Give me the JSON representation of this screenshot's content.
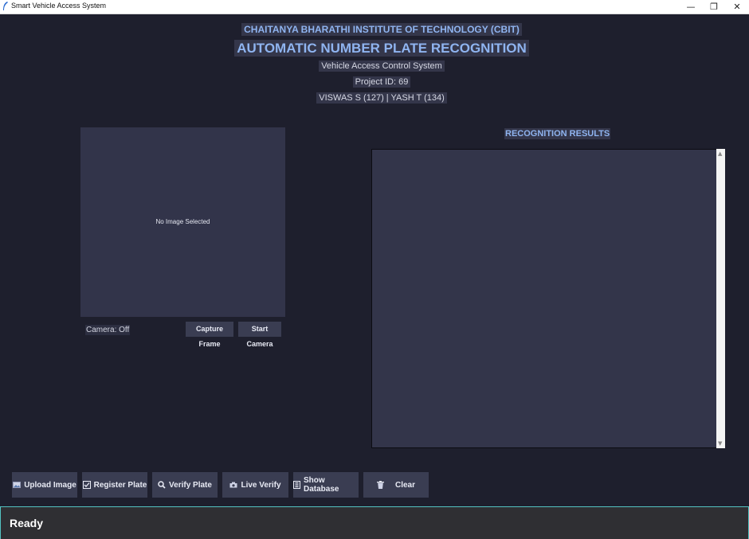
{
  "window": {
    "title": "Smart Vehicle Access System",
    "controls": {
      "minimize": "—",
      "restore": "❐",
      "close": "✕"
    }
  },
  "header": {
    "institute": "CHAITANYA BHARATHI INSTITUTE OF TECHNOLOGY (CBIT)",
    "title": "AUTOMATIC NUMBER PLATE RECOGNITION",
    "subtitle": "Vehicle Access Control System",
    "project_id": "Project ID: 69",
    "authors": "VISWAS S (127) | YASH T (134)"
  },
  "image_panel": {
    "placeholder": "No Image Selected"
  },
  "camera": {
    "status": "Camera: Off",
    "capture_label": "Capture Frame",
    "start_label": "Start Camera"
  },
  "results": {
    "title": "RECOGNITION RESULTS",
    "content": ""
  },
  "actions": [
    {
      "label": "Upload Image",
      "icon": "image-icon"
    },
    {
      "label": "Register Plate",
      "icon": "checkbox-icon"
    },
    {
      "label": "Verify Plate",
      "icon": "magnifier-icon"
    },
    {
      "label": "Live Verify",
      "icon": "camera-icon"
    },
    {
      "label": "Show Database",
      "icon": "database-icon"
    },
    {
      "label": "Clear",
      "icon": "trash-icon"
    }
  ],
  "status": {
    "text": "Ready"
  },
  "colors": {
    "background": "#1e1f2d",
    "accent": "#8fb4f0",
    "panel": "#32344a",
    "status_border": "#53c3c3"
  }
}
